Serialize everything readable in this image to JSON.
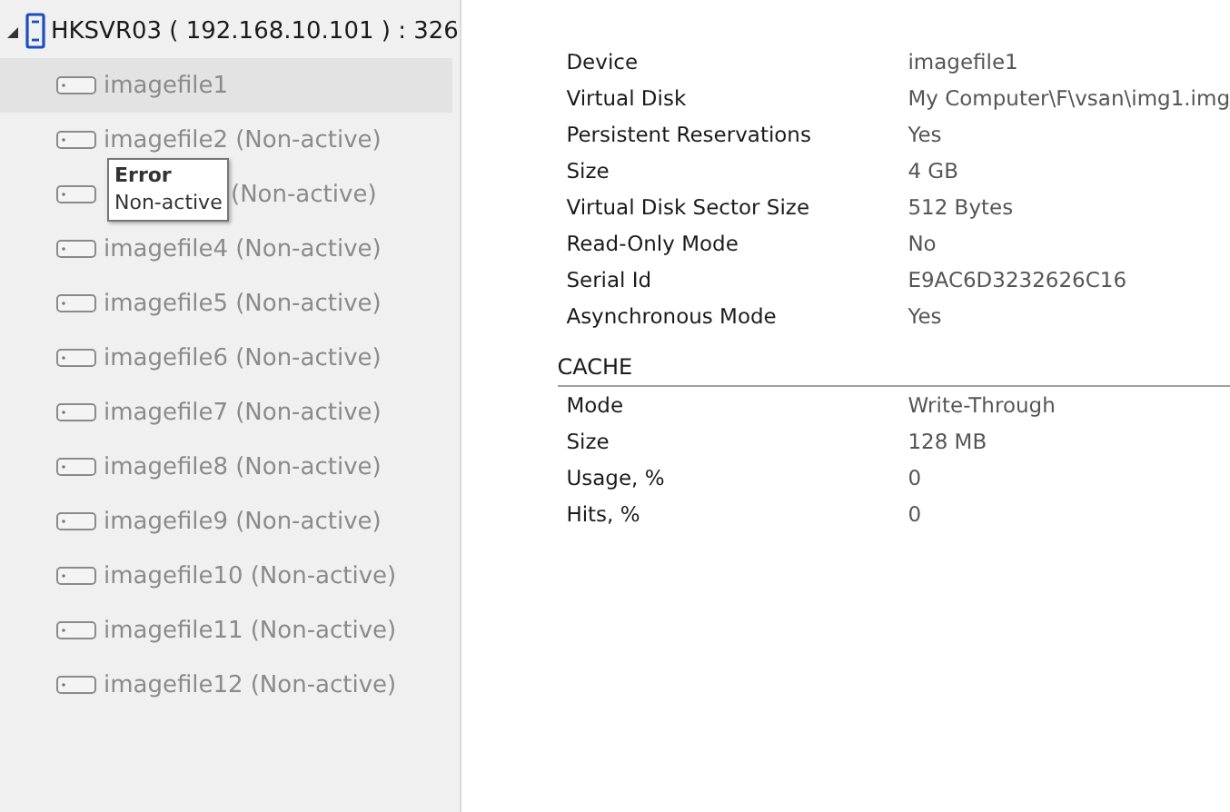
{
  "tree": {
    "root": {
      "label": "HKSVR03 ( 192.168.10.101 ) : 326",
      "expanded": true,
      "children": [
        {
          "name": "imagefile1",
          "selected": true
        },
        {
          "name": "imagefile2",
          "status": "(Non-active)",
          "selected": false
        },
        {
          "status": "(Non-active)",
          "selected": false
        },
        {
          "name": "imagefile4",
          "status": "(Non-active)",
          "selected": false
        },
        {
          "name": "imagefile5",
          "status": "(Non-active)",
          "selected": false
        },
        {
          "name": "imagefile6",
          "status": "(Non-active)",
          "selected": false
        },
        {
          "name": "imagefile7",
          "status": "(Non-active)",
          "selected": false
        },
        {
          "name": "imagefile8",
          "status": "(Non-active)",
          "selected": false
        },
        {
          "name": "imagefile9",
          "status": "(Non-active)",
          "selected": false
        },
        {
          "name": "imagefile10",
          "status": "(Non-active)",
          "selected": false
        },
        {
          "name": "imagefile11",
          "status": "(Non-active)",
          "selected": false
        },
        {
          "name": "imagefile12",
          "status": "(Non-active)",
          "selected": false
        }
      ]
    }
  },
  "tooltip": {
    "title": "Error",
    "text": "Non-active"
  },
  "properties": [
    {
      "label": "Device",
      "value": "imagefile1"
    },
    {
      "label": "Virtual Disk",
      "value": "My Computer\\F\\vsan\\img1.img"
    },
    {
      "label": "Persistent Reservations",
      "value": "Yes"
    },
    {
      "label": "Size",
      "value": "4 GB"
    },
    {
      "label": "Virtual Disk Sector Size",
      "value": "512 Bytes"
    },
    {
      "label": "Read-Only Mode",
      "value": "No"
    },
    {
      "label": "Serial Id",
      "value": "E9AC6D3232626C16"
    },
    {
      "label": "Asynchronous Mode",
      "value": "Yes"
    }
  ],
  "cache": {
    "title": "CACHE",
    "properties": [
      {
        "label": "Mode",
        "value": "Write-Through"
      },
      {
        "label": "Size",
        "value": "128 MB"
      },
      {
        "label": "Usage, %",
        "value": "0"
      },
      {
        "label": "Hits, %",
        "value": "0"
      }
    ]
  }
}
